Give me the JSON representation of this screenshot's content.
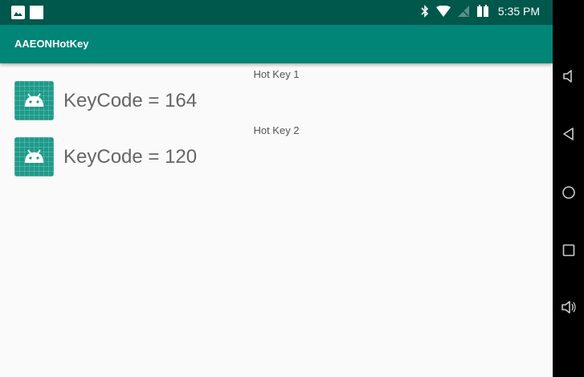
{
  "status_bar": {
    "time": "5:35 PM",
    "icons": [
      "gallery-icon",
      "square-notification-icon",
      "bluetooth-icon",
      "wifi-icon",
      "no-sim-icon",
      "battery-icon"
    ]
  },
  "app_bar": {
    "title": "AAEONHotKey",
    "color": "#008577",
    "status_color": "#00574b"
  },
  "hotkeys": [
    {
      "label": "Hot Key 1",
      "text": "KeyCode = 164",
      "icon": "android-launcher-icon"
    },
    {
      "label": "Hot Key 2",
      "text": "KeyCode = 120",
      "icon": "android-launcher-icon"
    }
  ],
  "nav_bar": {
    "buttons": [
      "volume-down-icon",
      "back-icon",
      "home-icon",
      "recents-icon",
      "volume-up-icon"
    ]
  }
}
